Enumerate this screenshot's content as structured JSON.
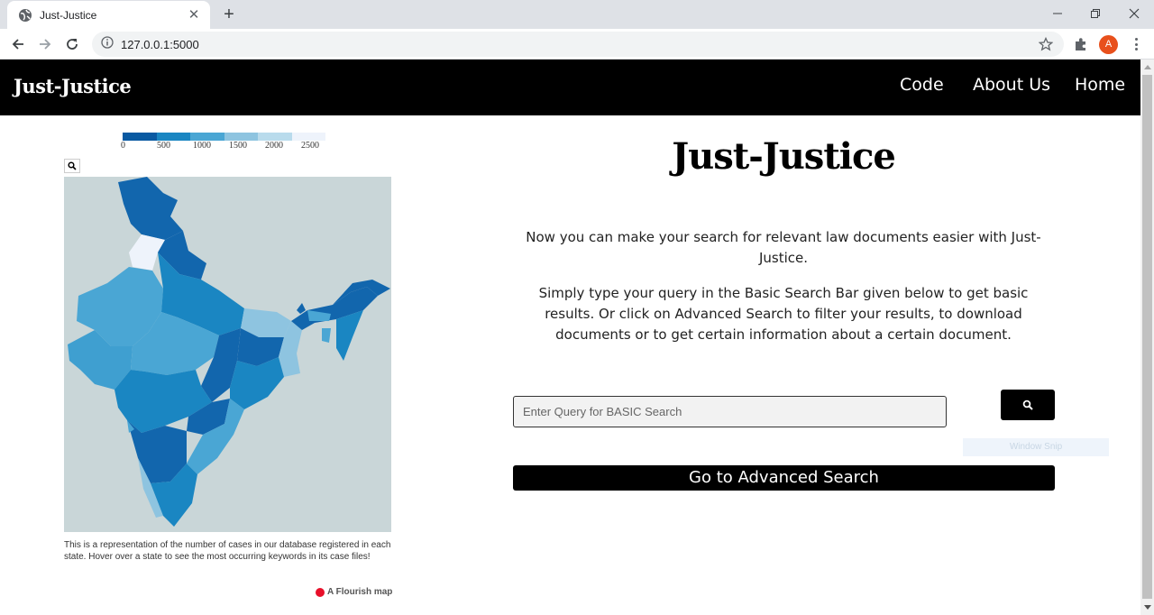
{
  "browser": {
    "tab_title": "Just-Justice",
    "tab_close": "✕",
    "new_tab": "+",
    "url": "127.0.0.1:5000",
    "profile_initial": "A"
  },
  "navbar": {
    "brand": "Just-Justice",
    "links": [
      "Code",
      "About Us",
      "Home"
    ]
  },
  "map": {
    "legend": {
      "colors": [
        "#0a5aa2",
        "#1a86c2",
        "#4aa6d4",
        "#8ec4e0",
        "#b9dbec",
        "#eef3fb"
      ],
      "labels": [
        "0",
        "500",
        "1000",
        "1500",
        "2000",
        "2500"
      ]
    },
    "caption": "This is a representation of the number of cases in our database registered in each state. Hover over a state to see the most occurring keywords in its case files!",
    "credit": "A Flourish map"
  },
  "main": {
    "title": "Just-Justice",
    "intro": "Now you can make your search for relevant law documents easier with Just-Justice.",
    "instructions": "Simply type your query in the Basic Search Bar given below to get basic results. Or click on Advanced Search to filter your results, to download documents or to get certain information about a certain document.",
    "search_placeholder": "Enter Query for BASIC Search",
    "window_snip": "Window Snip",
    "advanced_button": "Go to Advanced Search"
  }
}
